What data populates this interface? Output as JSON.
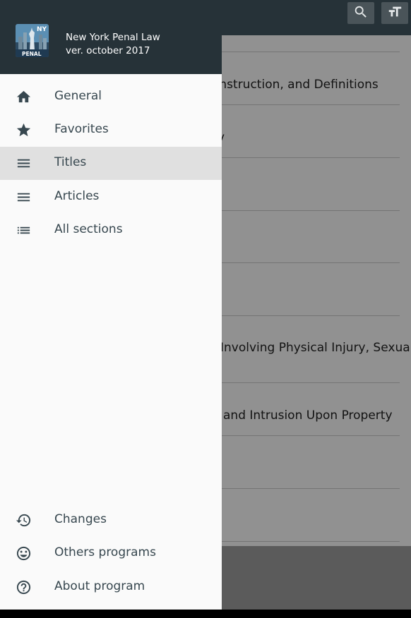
{
  "toolbar": {
    "search_icon": "search-icon",
    "text_size_icon": "text-size-icon"
  },
  "list": {
    "rows": [
      {
        "text": "onstruction, and Definitions"
      },
      {
        "text": "y"
      },
      {
        "text": ""
      },
      {
        "text": ""
      },
      {
        "text": ""
      },
      {
        "text": "Involving Physical Injury, Sexual"
      },
      {
        "text": "and Intrusion Upon Property"
      },
      {
        "text": ""
      },
      {
        "text": ""
      }
    ]
  },
  "drawer": {
    "header": {
      "logo_text_top": "NY",
      "logo_text_bottom": "PENAL",
      "title": "New York Penal Law",
      "version": "ver. october 2017"
    },
    "items": [
      {
        "label": "General",
        "icon": "home-icon"
      },
      {
        "label": "Favorites",
        "icon": "star-icon"
      },
      {
        "label": "Titles",
        "icon": "menu-icon",
        "selected": true
      },
      {
        "label": "Articles",
        "icon": "menu-icon"
      },
      {
        "label": "All sections",
        "icon": "list-icon"
      }
    ],
    "bottom_items": [
      {
        "label": "Changes",
        "icon": "history-icon"
      },
      {
        "label": "Others programs",
        "icon": "smiley-icon"
      },
      {
        "label": "About program",
        "icon": "help-icon"
      }
    ]
  },
  "colors": {
    "toolbar": "#263238",
    "drawer_bg": "#fafafa",
    "selected_bg": "#e0e0e0",
    "icon_text": "#37474f"
  }
}
